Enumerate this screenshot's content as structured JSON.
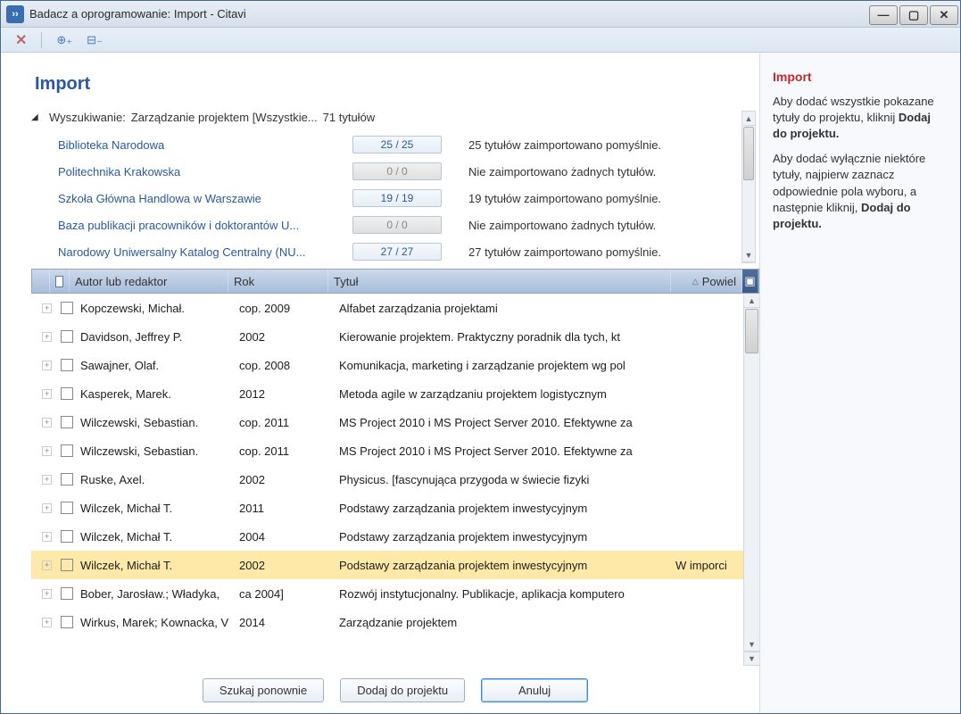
{
  "window": {
    "title": "Badacz a oprogramowanie: Import - Citavi"
  },
  "page": {
    "title": "Import"
  },
  "search": {
    "label_prefix": "Wyszukiwanie:",
    "query": "Zarządzanie  projektem  [Wszystkie...",
    "count_text": "71 tytułów"
  },
  "sources": [
    {
      "name": "Biblioteka Narodowa",
      "count": "25 / 25",
      "gray": false,
      "status": "25 tytułów zaimportowano pomyślnie."
    },
    {
      "name": "Politechnika Krakowska",
      "count": "0 / 0",
      "gray": true,
      "status": "Nie zaimportowano żadnych tytułów."
    },
    {
      "name": "Szkoła Główna Handlowa w Warszawie",
      "count": "19 / 19",
      "gray": false,
      "status": "19 tytułów zaimportowano pomyślnie."
    },
    {
      "name": "Baza publikacji pracowników i doktorantów U...",
      "count": "0 / 0",
      "gray": true,
      "status": "Nie zaimportowano żadnych tytułów."
    },
    {
      "name": "Narodowy  Uniwersalny  Katalog  Centralny  (NU...",
      "count": "27 / 27",
      "gray": false,
      "status": "27 tytułów zaimportowano pomyślnie."
    }
  ],
  "grid": {
    "headers": {
      "author": "Autor lub redaktor",
      "year": "Rok",
      "title": "Tytuł",
      "dup": "Powiel"
    },
    "rows": [
      {
        "author": "Kopczewski, Michał.",
        "year": "cop. 2009",
        "title": "Alfabet zarządzania projektami",
        "dup": "",
        "hl": false
      },
      {
        "author": "Davidson, Jeffrey P.",
        "year": "2002",
        "title": "Kierowanie projektem. Praktyczny poradnik dla tych, kt",
        "dup": "",
        "hl": false
      },
      {
        "author": "Sawajner, Olaf.",
        "year": "cop. 2008",
        "title": "Komunikacja, marketing i zarządzanie projektem wg pol",
        "dup": "",
        "hl": false
      },
      {
        "author": "Kasperek, Marek.",
        "year": "2012",
        "title": "Metoda agile w zarządzaniu projektem logistycznym",
        "dup": "",
        "hl": false
      },
      {
        "author": "Wilczewski, Sebastian.",
        "year": "cop. 2011",
        "title": "MS Project 2010 i MS Project Server 2010. Efektywne za",
        "dup": "",
        "hl": false
      },
      {
        "author": "Wilczewski, Sebastian.",
        "year": "cop. 2011",
        "title": "MS Project 2010 i MS Project Server 2010. Efektywne za",
        "dup": "",
        "hl": false
      },
      {
        "author": "Ruske, Axel.",
        "year": "2002",
        "title": "Physicus. [fascynująca przygoda w świecie fizyki",
        "dup": "",
        "hl": false
      },
      {
        "author": "Wilczek, Michał T.",
        "year": "2011",
        "title": "Podstawy zarządzania projektem inwestycyjnym",
        "dup": "",
        "hl": false
      },
      {
        "author": "Wilczek, Michał T.",
        "year": "2004",
        "title": "Podstawy zarządzania projektem inwestycyjnym",
        "dup": "",
        "hl": false
      },
      {
        "author": "Wilczek, Michał T.",
        "year": "2002",
        "title": "Podstawy zarządzania projektem inwestycyjnym",
        "dup": "W imporci",
        "hl": true
      },
      {
        "author": "Bober, Jarosław.; Władyka,",
        "year": "ca 2004]",
        "title": "Rozwój instytucjonalny. Publikacje, aplikacja komputero",
        "dup": "",
        "hl": false
      },
      {
        "author": "Wirkus, Marek; Kownacka, V",
        "year": "2014",
        "title": "Zarządzanie projektem",
        "dup": "",
        "hl": false
      }
    ]
  },
  "buttons": {
    "search_again": "Szukaj ponownie",
    "add": "Dodaj do projektu",
    "cancel": "Anuluj"
  },
  "help": {
    "title": "Import",
    "p1a": "Aby dodać wszystkie pokazane tytuły do projektu, kliknij ",
    "p1b": "Dodaj do projektu.",
    "p2a": "Aby dodać wyłącznie niektóre tytuły, najpierw zaznacz odpowiednie pola wyboru, a następnie kliknij, ",
    "p2b": "Dodaj do projektu."
  }
}
